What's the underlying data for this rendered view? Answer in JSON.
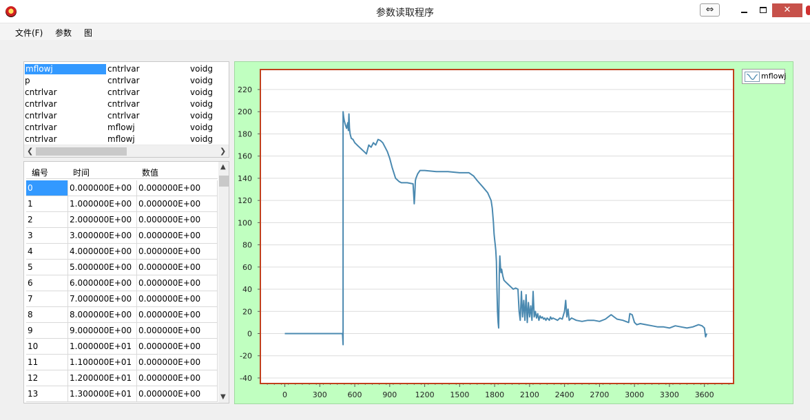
{
  "window": {
    "title": "参数读取程序",
    "snap_glyph": "⇔",
    "close_glyph": "✕",
    "icon": "app-icon"
  },
  "menu": [
    "文件(F)",
    "参数",
    "图"
  ],
  "variable_list": {
    "rows": [
      [
        "mflowj",
        "cntrlvar",
        "voidg"
      ],
      [
        "p",
        "cntrlvar",
        "voidg"
      ],
      [
        "cntrlvar",
        "cntrlvar",
        "voidg"
      ],
      [
        "cntrlvar",
        "cntrlvar",
        "voidg"
      ],
      [
        "cntrlvar",
        "cntrlvar",
        "voidg"
      ],
      [
        "cntrlvar",
        "mflowj",
        "voidg"
      ],
      [
        "cntrlvar",
        "mflowj",
        "voidg"
      ]
    ],
    "selected_row": 0
  },
  "data_grid": {
    "headers": [
      "编号",
      "时间",
      "数值"
    ],
    "rows": [
      [
        "0",
        "0.000000E+00",
        "0.000000E+00"
      ],
      [
        "1",
        "1.000000E+00",
        "0.000000E+00"
      ],
      [
        "2",
        "2.000000E+00",
        "0.000000E+00"
      ],
      [
        "3",
        "3.000000E+00",
        "0.000000E+00"
      ],
      [
        "4",
        "4.000000E+00",
        "0.000000E+00"
      ],
      [
        "5",
        "5.000000E+00",
        "0.000000E+00"
      ],
      [
        "6",
        "6.000000E+00",
        "0.000000E+00"
      ],
      [
        "7",
        "7.000000E+00",
        "0.000000E+00"
      ],
      [
        "8",
        "8.000000E+00",
        "0.000000E+00"
      ],
      [
        "9",
        "9.000000E+00",
        "0.000000E+00"
      ],
      [
        "10",
        "1.000000E+01",
        "0.000000E+00"
      ],
      [
        "11",
        "1.100000E+01",
        "0.000000E+00"
      ],
      [
        "12",
        "1.200000E+01",
        "0.000000E+00"
      ],
      [
        "13",
        "1.300000E+01",
        "0.000000E+00"
      ]
    ],
    "selected_row": 0
  },
  "chart_data": {
    "type": "line",
    "title": "",
    "xlabel": "",
    "ylabel": "",
    "xlim": [
      -210,
      3850
    ],
    "ylim": [
      -45,
      238
    ],
    "xticks": [
      0,
      300,
      600,
      900,
      1200,
      1500,
      1800,
      2100,
      2400,
      2700,
      3000,
      3300,
      3600
    ],
    "yticks": [
      -40,
      -20,
      0,
      20,
      40,
      60,
      80,
      100,
      120,
      140,
      160,
      180,
      200,
      220
    ],
    "grid": "horizontal",
    "legend": "top-right",
    "colors": {
      "line": "#4a89b0",
      "frame": "#c0401c",
      "panel": "#c0ffc0"
    },
    "series": [
      {
        "name": "mflowj",
        "x": [
          0,
          300,
          495,
          500,
          500,
          505,
          510,
          520,
          530,
          540,
          545,
          550,
          555,
          560,
          570,
          585,
          600,
          620,
          640,
          660,
          680,
          700,
          720,
          740,
          760,
          780,
          800,
          820,
          840,
          860,
          880,
          900,
          920,
          950,
          980,
          1000,
          1050,
          1100,
          1110,
          1115,
          1120,
          1125,
          1140,
          1160,
          1200,
          1300,
          1400,
          1500,
          1580,
          1620,
          1650,
          1700,
          1740,
          1770,
          1780,
          1790,
          1795,
          1800,
          1805,
          1810,
          1815,
          1820,
          1825,
          1830,
          1835,
          1840,
          1845,
          1850,
          1855,
          1860,
          1870,
          1880,
          1900,
          1920,
          1940,
          1960,
          1980,
          2000,
          2010,
          2020,
          2030,
          2040,
          2050,
          2060,
          2070,
          2080,
          2090,
          2100,
          2110,
          2120,
          2130,
          2140,
          2150,
          2160,
          2170,
          2180,
          2190,
          2200,
          2210,
          2220,
          2230,
          2240,
          2250,
          2260,
          2270,
          2280,
          2290,
          2300,
          2320,
          2340,
          2360,
          2380,
          2400,
          2410,
          2420,
          2430,
          2440,
          2460,
          2480,
          2500,
          2550,
          2600,
          2650,
          2700,
          2750,
          2800,
          2850,
          2900,
          2950,
          2960,
          2980,
          3000,
          3020,
          3050,
          3100,
          3150,
          3200,
          3250,
          3300,
          3350,
          3400,
          3450,
          3500,
          3550,
          3580,
          3600,
          3610,
          3620
        ],
        "values": [
          0,
          0,
          0,
          -10,
          200,
          195,
          192,
          188,
          185,
          190,
          183,
          198,
          185,
          180,
          176,
          175,
          172,
          170,
          168,
          166,
          164,
          162,
          170,
          168,
          172,
          170,
          175,
          174,
          172,
          168,
          164,
          158,
          150,
          140,
          137,
          136,
          136,
          135,
          117,
          125,
          138,
          140,
          144,
          147,
          147,
          146,
          146,
          145,
          145,
          142,
          138,
          132,
          127,
          120,
          113,
          100,
          90,
          85,
          80,
          75,
          65,
          40,
          20,
          10,
          5,
          55,
          70,
          60,
          55,
          58,
          52,
          48,
          46,
          44,
          42,
          40,
          41,
          40,
          20,
          12,
          38,
          15,
          30,
          12,
          35,
          10,
          28,
          15,
          25,
          12,
          38,
          15,
          20,
          14,
          18,
          12,
          16,
          14,
          15,
          13,
          14,
          12,
          14,
          13,
          12,
          15,
          13,
          14,
          13,
          12,
          14,
          13,
          20,
          30,
          15,
          22,
          12,
          14,
          13,
          12,
          11,
          12,
          12,
          11,
          13,
          17,
          13,
          12,
          10,
          18,
          17,
          10,
          8,
          9,
          8,
          7,
          6,
          6,
          5,
          7,
          6,
          5,
          6,
          8,
          7,
          5,
          -3,
          0
        ]
      }
    ]
  }
}
